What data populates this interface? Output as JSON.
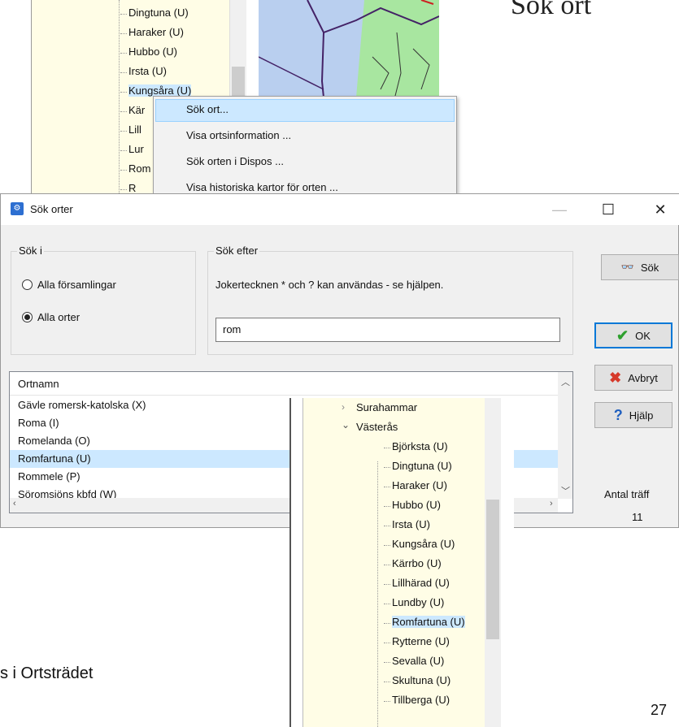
{
  "heading": "Sök ort",
  "top_tree": {
    "items": [
      "Dingtuna (U)",
      "Haraker (U)",
      "Hubbo (U)",
      "Irsta (U)",
      "Kungsåra (U)",
      "Kär",
      "Lill",
      "Lur",
      "Rom",
      "R"
    ]
  },
  "context_menu": {
    "items": [
      "Sök ort...",
      "Visa ortsinformation ...",
      "Sök orten i Dispos ...",
      "Visa historiska kartor för orten ..."
    ]
  },
  "dialog": {
    "title": "Sök orter",
    "minimize": "—",
    "maximize": "☐",
    "close": "✕",
    "search_in": {
      "label": "Sök i",
      "options": [
        {
          "label": "Alla församlingar",
          "selected": false
        },
        {
          "label": "Alla orter",
          "selected": true
        }
      ]
    },
    "search_for": {
      "label": "Sök efter",
      "hint": "Jokertecknen * och ? kan användas - se hjälpen.",
      "value": "rom"
    },
    "buttons": {
      "search": "Sök",
      "ok": "OK",
      "cancel": "Avbryt",
      "help": "Hjälp"
    },
    "results": {
      "header": "Ortnamn",
      "rows": [
        "Gävle romersk-katolska (X)",
        "Roma (I)",
        "Romelanda (O)",
        "Romfartuna (U)",
        "Rommele (P)",
        "Söromsjöns kbfd (W)"
      ],
      "selected_row": "Romfartuna (U)"
    },
    "count": {
      "label": "Antal träff",
      "value": "11"
    }
  },
  "bottom_tree": {
    "parents": [
      "Surahammar",
      "Västerås"
    ],
    "children": [
      "Björksta (U)",
      "Dingtuna (U)",
      "Haraker (U)",
      "Hubbo (U)",
      "Irsta (U)",
      "Kungsåra (U)",
      "Kärrbo (U)",
      "Lillhärad (U)",
      "Lundby (U)",
      "Romfartuna (U)",
      "Rytterne (U)",
      "Sevalla (U)",
      "Skultuna (U)",
      "Tillberga (U)"
    ],
    "selected": "Romfartuna (U)"
  },
  "bottom_text": "s i Ortsträdet",
  "page_number": "27"
}
